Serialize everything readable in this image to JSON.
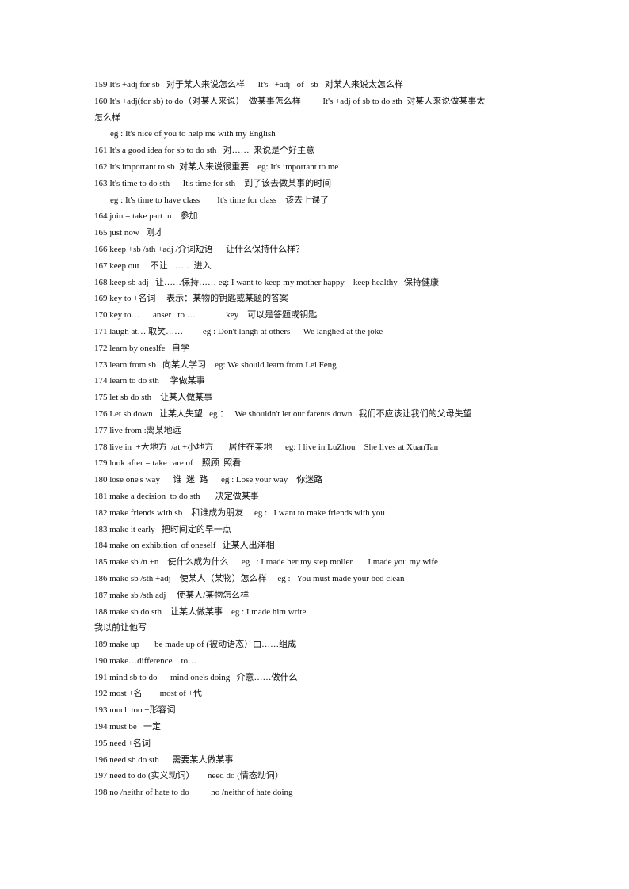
{
  "document": {
    "lines": [
      {
        "text": "159 It's +adj for sb   对于某人来说怎么样      It's   +adj   of   sb   对某人来说太怎么样",
        "indent": false
      },
      {
        "text": "160 It's +adj(for sb) to do（对某人来说）  做某事怎么样          It's +adj of sb to do sth  对某人来说做某事太",
        "indent": false
      },
      {
        "text": "怎么样",
        "indent": false
      },
      {
        "text": "eg : It's nice of you to help me with my English",
        "indent": true
      },
      {
        "text": "161 It's a good idea for sb to do sth   对……  来说是个好主意",
        "indent": false
      },
      {
        "text": "162 It's important to sb  对某人来说很重要    eg: It's important to me",
        "indent": false
      },
      {
        "text": "163 It's time to do sth      It's time for sth    到了该去做某事的时间",
        "indent": false
      },
      {
        "text": "eg : It's time to have class        It's time for class    该去上课了",
        "indent": true
      },
      {
        "text": "164 join = take part in    参加",
        "indent": false
      },
      {
        "text": "165 just now   刚才",
        "indent": false
      },
      {
        "text": "166 keep +sb /sth +adj /介词短语      让什么保持什么样？",
        "indent": false
      },
      {
        "text": "167 keep out     不让  ……  进入",
        "indent": false
      },
      {
        "text": "168 keep sb adj   让……保持…… eg: I want to keep my mother happy    keep healthy   保持健康",
        "indent": false
      },
      {
        "text": "169 key to +名词     表示：某物的钥匙或某题的答案",
        "indent": false
      },
      {
        "text": "170 key to…      anser   to …              key    可以是答题或钥匙",
        "indent": false
      },
      {
        "text": "171 laugh at… 取笑……         eg : Don't langh at others      We langhed at the joke",
        "indent": false
      },
      {
        "text": "172 learn by oneslfe   自学",
        "indent": false
      },
      {
        "text": "173 learn from sb   向某人学习    eg: We should learn from Lei Feng",
        "indent": false
      },
      {
        "text": "174 learn to do sth     学做某事",
        "indent": false
      },
      {
        "text": "175 let sb do sth    让某人做某事",
        "indent": false
      },
      {
        "text": "176 Let sb down   让某人失望   eg ：   We shouldn't let our farents down   我们不应该让我们的父母失望",
        "indent": false
      },
      {
        "text": "177 live from :离某地远",
        "indent": false
      },
      {
        "text": "178 live in  +大地方  /at +小地方       居住在某地      eg: I live in LuZhou    She lives at XuanTan",
        "indent": false
      },
      {
        "text": "179 look after = take care of    照顾  照看",
        "indent": false
      },
      {
        "text": "180 lose one's way      谁  迷  路      eg : Lose your way    你迷路",
        "indent": false
      },
      {
        "text": "181 make a decision  to do sth       决定做某事",
        "indent": false
      },
      {
        "text": "182 make friends with sb    和谁成为朋友     eg :   I want to make friends with you",
        "indent": false
      },
      {
        "text": "183 make it early   把时间定的早一点",
        "indent": false
      },
      {
        "text": "184 make on exhibition  of oneself   让某人出洋相",
        "indent": false
      },
      {
        "text": "185 make sb /n +n    使什么成为什么      eg   : I made her my step moller       I made you my wife",
        "indent": false
      },
      {
        "text": "186 make sb /sth +adj    使某人（某物）怎么样     eg :   You must made your bed clean",
        "indent": false
      },
      {
        "text": "187 make sb /sth adj     使某人/某物怎么样",
        "indent": false
      },
      {
        "text": "188 make sb do sth    让某人做某事    eg : I made him write",
        "indent": false
      },
      {
        "text": "我以前让他写",
        "indent": false
      },
      {
        "text": "189 make up       be made up of (被动语态）由……组成",
        "indent": false
      },
      {
        "text": "190 make…difference    to…",
        "indent": false
      },
      {
        "text": "191 mind sb to do      mind one's doing   介意……做什么",
        "indent": false
      },
      {
        "text": "192 most +名        most of +代",
        "indent": false
      },
      {
        "text": "193 much too +形容词",
        "indent": false
      },
      {
        "text": "194 must be   一定",
        "indent": false
      },
      {
        "text": "195 need +名词",
        "indent": false
      },
      {
        "text": "196 need sb do sth      需要某人做某事",
        "indent": false
      },
      {
        "text": "197 need to do (实义动词）      need do (情态动词）",
        "indent": false
      },
      {
        "text": "198 no /neithr of hate to do          no /neithr of hate doing",
        "indent": false
      }
    ]
  }
}
